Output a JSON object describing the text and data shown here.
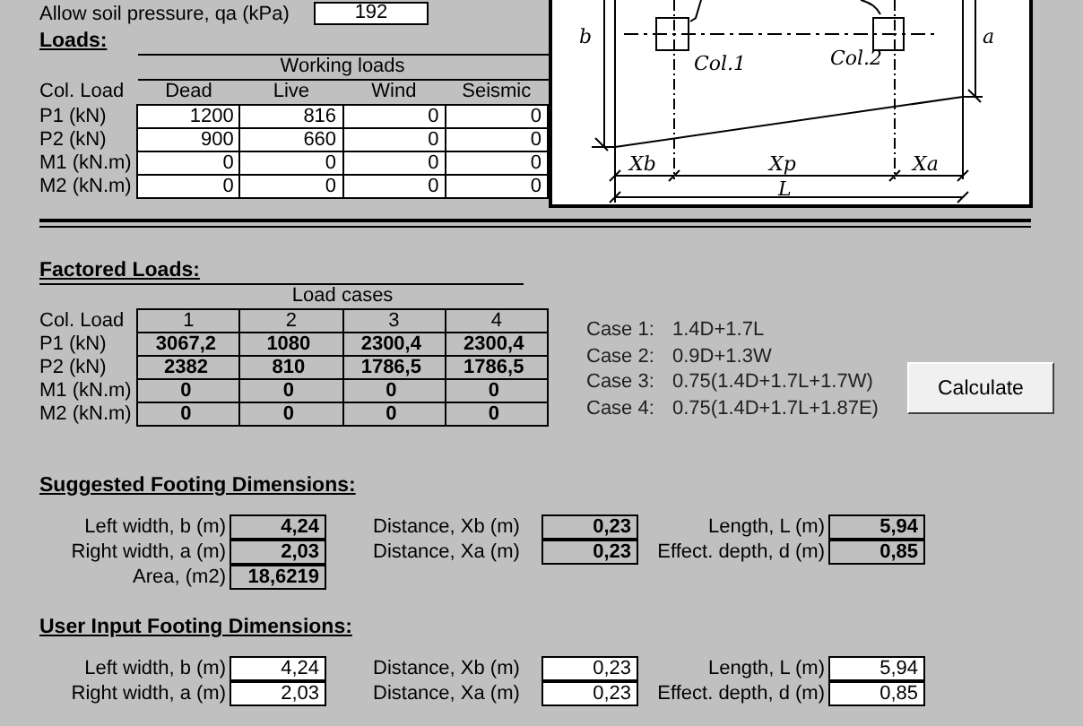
{
  "soil_pressure": {
    "label": "Allow soil pressure, qa (kPa)",
    "value": "192"
  },
  "loads": {
    "heading": "Loads:",
    "group_header": "Working loads",
    "corner_label": "Col. Load",
    "kind": "input",
    "columns": [
      "Dead",
      "Live",
      "Wind",
      "Seismic"
    ],
    "rows": [
      {
        "label": "P1 (kN)",
        "values": [
          "1200",
          "816",
          "0",
          "0"
        ]
      },
      {
        "label": "P2 (kN)",
        "values": [
          "900",
          "660",
          "0",
          "0"
        ]
      },
      {
        "label": "M1 (kN.m)",
        "values": [
          "0",
          "0",
          "0",
          "0"
        ]
      },
      {
        "label": "M2 (kN.m)",
        "values": [
          "0",
          "0",
          "0",
          "0"
        ]
      }
    ]
  },
  "diagram": {
    "labels": {
      "b": "b",
      "a": "a",
      "col1": "Col.1",
      "col2": "Col.2",
      "xb": "Xb",
      "xp": "Xp",
      "xa": "Xa",
      "l": "L"
    }
  },
  "factored_loads": {
    "heading": "Factored Loads:",
    "group_header": "Load cases",
    "corner_label": "Col. Load",
    "kind": "output",
    "columns": [
      "1",
      "2",
      "3",
      "4"
    ],
    "rows": [
      {
        "label": "P1 (kN)",
        "values": [
          "3067,2",
          "1080",
          "2300,4",
          "2300,4"
        ]
      },
      {
        "label": "P2 (kN)",
        "values": [
          "2382",
          "810",
          "1786,5",
          "1786,5"
        ]
      },
      {
        "label": "M1 (kN.m)",
        "values": [
          "0",
          "0",
          "0",
          "0"
        ]
      },
      {
        "label": "M2 (kN.m)",
        "values": [
          "0",
          "0",
          "0",
          "0"
        ]
      }
    ]
  },
  "cases": [
    {
      "label": "Case 1:",
      "formula": "1.4D+1.7L"
    },
    {
      "label": "Case 2:",
      "formula": "0.9D+1.3W"
    },
    {
      "label": "Case 3:",
      "formula": "0.75(1.4D+1.7L+1.7W)"
    },
    {
      "label": "Case 4:",
      "formula": "0.75(1.4D+1.7L+1.87E)"
    }
  ],
  "calculate_button": "Calculate",
  "suggested_dimensions": {
    "heading": "Suggested Footing Dimensions:",
    "kind": "output",
    "rows": [
      [
        {
          "label": "Left width, b (m)",
          "value": "4,24"
        },
        {
          "label": "Distance, Xb (m)",
          "value": "0,23"
        },
        {
          "label": "Length, L (m)",
          "value": "5,94"
        }
      ],
      [
        {
          "label": "Right width, a (m)",
          "value": "2,03"
        },
        {
          "label": "Distance, Xa (m)",
          "value": "0,23"
        },
        {
          "label": "Effect. depth, d (m)",
          "value": "0,85"
        }
      ],
      [
        {
          "label": "Area, (m2)",
          "value": "18,6219"
        }
      ]
    ]
  },
  "user_dimensions": {
    "heading": "User Input Footing Dimensions:",
    "kind": "input",
    "rows": [
      [
        {
          "label": "Left width, b (m)",
          "value": "4,24"
        },
        {
          "label": "Distance, Xb (m)",
          "value": "0,23"
        },
        {
          "label": "Length, L (m)",
          "value": "5,94"
        }
      ],
      [
        {
          "label": "Right width, a (m)",
          "value": "2,03"
        },
        {
          "label": "Distance, Xa (m)",
          "value": "0,23"
        },
        {
          "label": "Effect. depth, d (m)",
          "value": "0,85"
        }
      ]
    ]
  }
}
